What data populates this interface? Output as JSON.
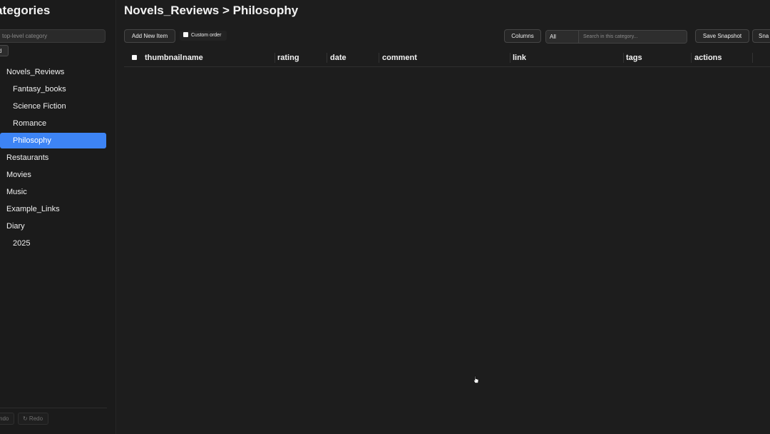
{
  "sidebar": {
    "title": "ategories",
    "add_input_placeholder": "top-level category",
    "add_button_label": "d",
    "items": [
      {
        "label": "Novels_Reviews",
        "level": 0,
        "active": false
      },
      {
        "label": "Fantasy_books",
        "level": 1,
        "active": false
      },
      {
        "label": "Science Fiction",
        "level": 1,
        "active": false
      },
      {
        "label": "Romance",
        "level": 1,
        "active": false
      },
      {
        "label": "Philosophy",
        "level": 1,
        "active": true
      },
      {
        "label": "Restaurants",
        "level": 0,
        "active": false
      },
      {
        "label": "Movies",
        "level": 0,
        "active": false
      },
      {
        "label": "Music",
        "level": 0,
        "active": false
      },
      {
        "label": "Example_Links",
        "level": 0,
        "active": false
      },
      {
        "label": "Diary",
        "level": 0,
        "active": false
      },
      {
        "label": "2025",
        "level": 1,
        "active": false
      }
    ],
    "undo_label": "ndo",
    "redo_label": "↻ Redo"
  },
  "main": {
    "breadcrumb": "Novels_Reviews > Philosophy",
    "add_item_label": "Add New Item",
    "custom_order_label": "Custom order",
    "columns_label": "Columns",
    "filter_selected": "All",
    "search_placeholder": "Search in this category...",
    "save_snapshot_label": "Save Snapshot",
    "snap_label": "Sna",
    "table_columns": [
      "thumbnail",
      "name",
      "rating",
      "date",
      "comment",
      "link",
      "tags",
      "actions"
    ]
  },
  "colors": {
    "accent": "#3d84f5",
    "background": "#1d1d1d"
  }
}
